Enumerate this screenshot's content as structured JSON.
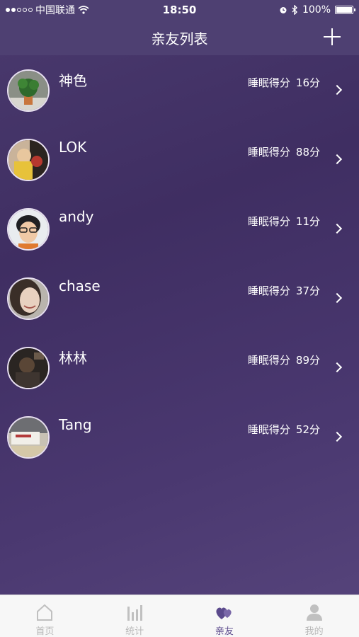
{
  "status": {
    "carrier": "中国联通",
    "time": "18:50",
    "battery": "100%"
  },
  "header": {
    "title": "亲友列表"
  },
  "friends": [
    {
      "name": "神色",
      "score_label": "睡眠得分",
      "score": "16分"
    },
    {
      "name": "LOK",
      "score_label": "睡眠得分",
      "score": "88分"
    },
    {
      "name": "andy",
      "score_label": "睡眠得分",
      "score": "11分"
    },
    {
      "name": "chase",
      "score_label": "睡眠得分",
      "score": "37分"
    },
    {
      "name": "林林",
      "score_label": "睡眠得分",
      "score": "89分"
    },
    {
      "name": "Tang",
      "score_label": "睡眠得分",
      "score": "52分"
    }
  ],
  "tabs": [
    {
      "label": "首页",
      "icon": "home-icon"
    },
    {
      "label": "统计",
      "icon": "stats-icon"
    },
    {
      "label": "亲友",
      "icon": "friends-icon",
      "active": true
    },
    {
      "label": "我的",
      "icon": "profile-icon"
    }
  ],
  "colors": {
    "accent": "#5b4a8c",
    "background": "#4a3a6e"
  }
}
